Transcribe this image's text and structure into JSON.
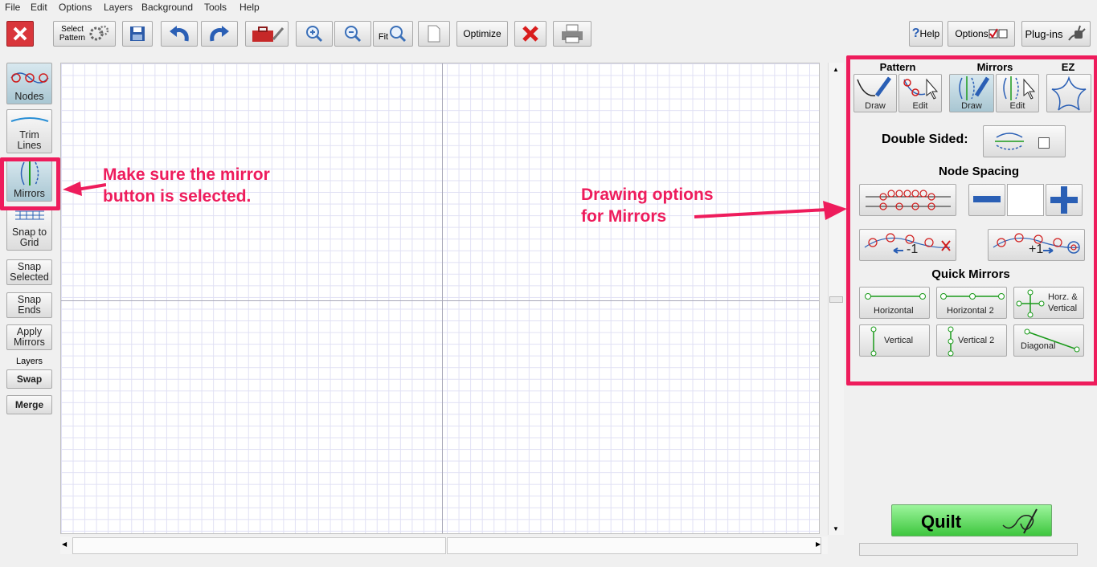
{
  "menu": [
    "File",
    "Edit",
    "Options",
    "Layers",
    "Background",
    "Tools",
    "Help"
  ],
  "toolbar": {
    "select_pattern_line1": "Select",
    "select_pattern_line2": "Pattern",
    "fit_label": "Fit",
    "optimize_label": "Optimize",
    "help_label": "Help",
    "options_label": "Options",
    "plugins_label": "Plug-ins"
  },
  "left_tools": {
    "nodes": "Nodes",
    "trim_line1": "Trim",
    "trim_line2": "Lines",
    "mirrors": "Mirrors",
    "snap_grid_line1": "Snap to",
    "snap_grid_line2": "Grid",
    "snap_selected_line1": "Snap",
    "snap_selected_line2": "Selected",
    "snap_ends_line1": "Snap",
    "snap_ends_line2": "Ends",
    "apply_mirrors_line1": "Apply",
    "apply_mirrors_line2": "Mirrors",
    "layers_label": "Layers",
    "swap": "Swap",
    "merge": "Merge"
  },
  "right_panel": {
    "pattern_header": "Pattern",
    "mirrors_header": "Mirrors",
    "ez_header": "EZ",
    "draw": "Draw",
    "edit": "Edit",
    "double_sided": "Double Sided:",
    "node_spacing": "Node Spacing",
    "minus_one": "-1",
    "plus_one": "+1",
    "quick_mirrors": "Quick Mirrors",
    "qm": {
      "horizontal": "Horizontal",
      "horizontal2": "Horizontal 2",
      "horz_vert_line1": "Horz. &",
      "horz_vert_line2": "Vertical",
      "vertical": "Vertical",
      "vertical2": "Vertical 2",
      "diagonal": "Diagonal"
    },
    "quilt": "Quilt"
  },
  "annotations": {
    "left_line1": "Make sure the mirror",
    "left_line2": "button is selected.",
    "right_line1": "Drawing options",
    "right_line2": "for Mirrors"
  },
  "colors": {
    "highlight": "#ee1c5c",
    "selected_button": "#a8c6d2",
    "quilt_button": "#3ec63e",
    "grid": "#e0e0f4"
  }
}
